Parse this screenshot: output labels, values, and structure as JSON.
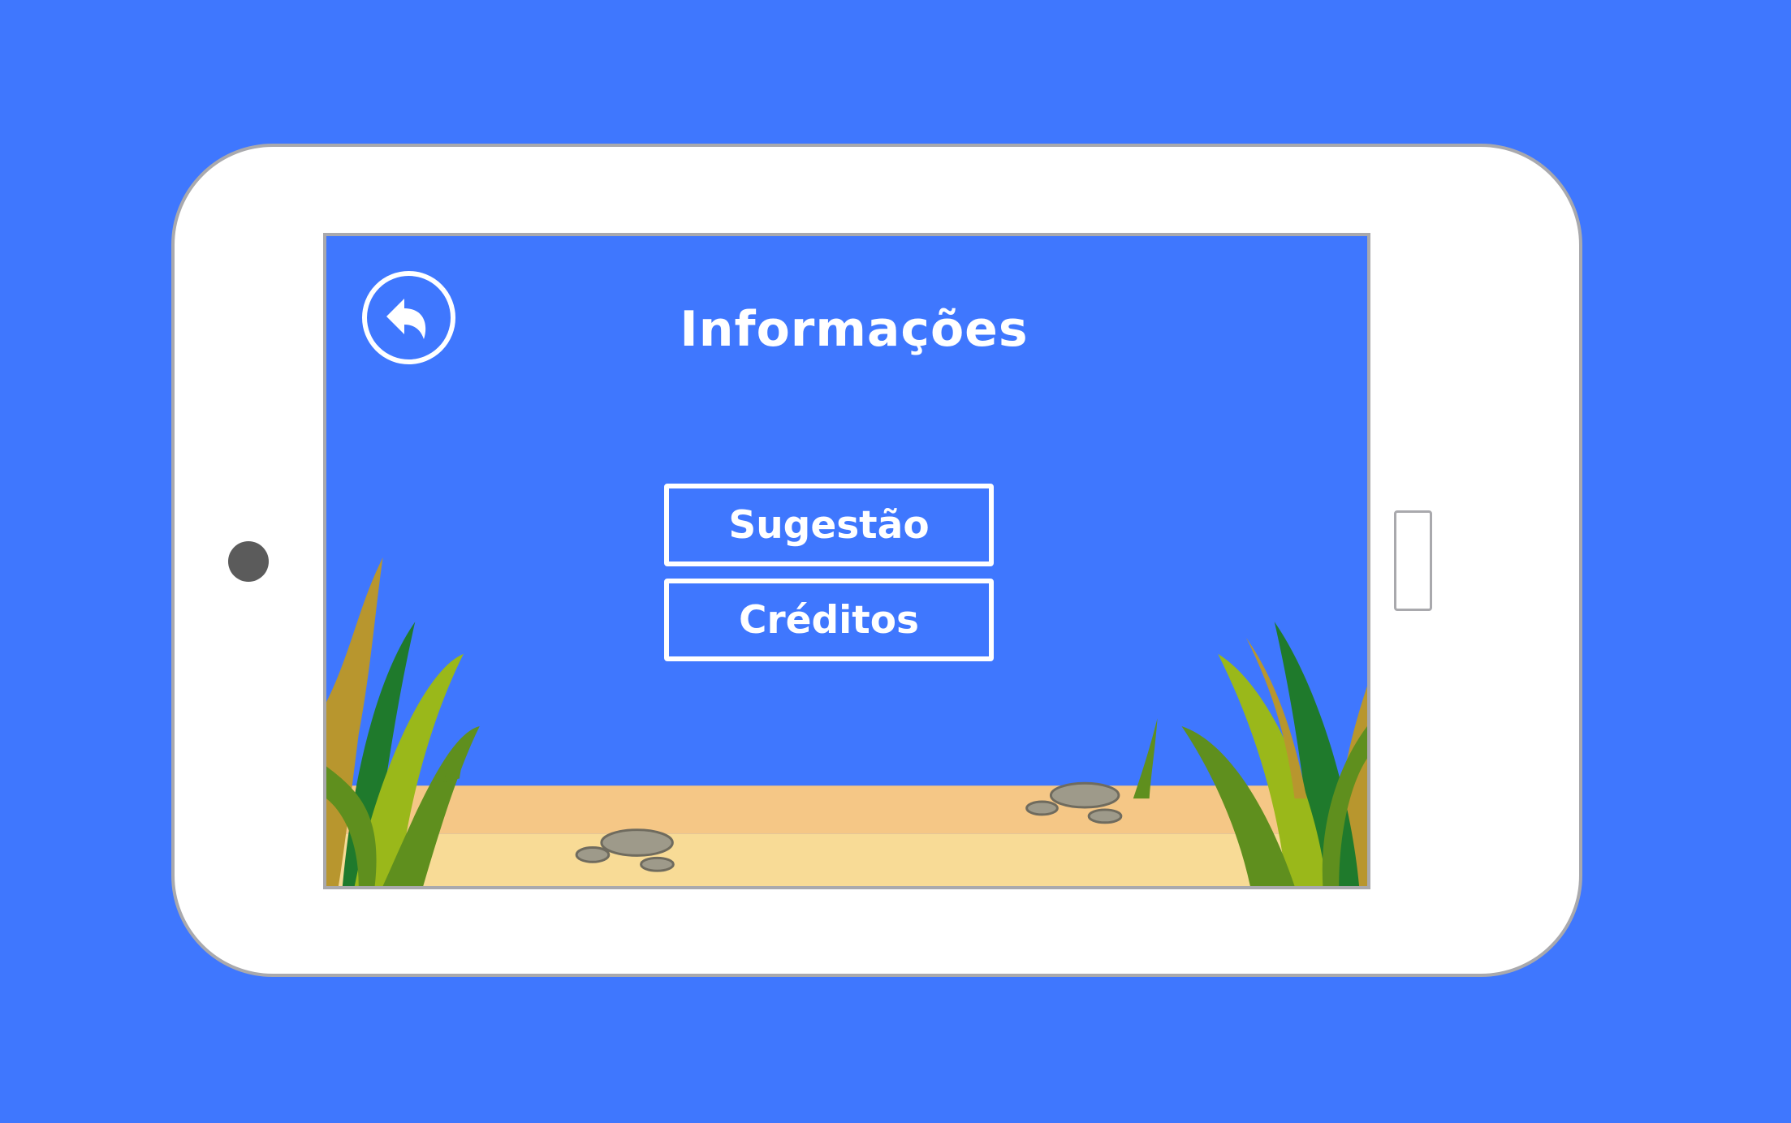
{
  "screen": {
    "title": "Informações",
    "back_icon": "back-arrow-icon",
    "menu": [
      {
        "label": "Sugestão"
      },
      {
        "label": "Créditos"
      }
    ]
  },
  "colors": {
    "background": "#3f77fe",
    "device_body": "#ffffff",
    "device_border": "#a9a9ad",
    "sand_light": "#f8db96",
    "sand_dark": "#f5c786",
    "rock": "#9e9a8a"
  }
}
